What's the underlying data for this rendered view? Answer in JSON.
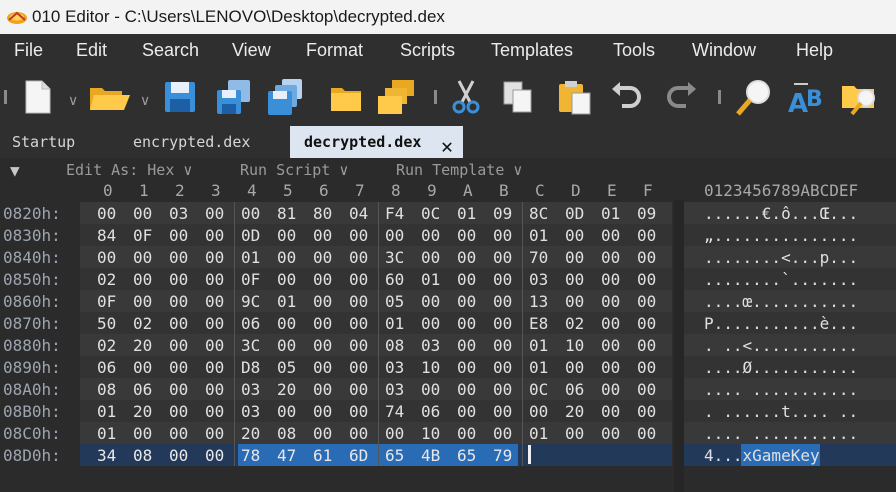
{
  "window": {
    "title": "010 Editor - C:\\Users\\LENOVO\\Desktop\\decrypted.dex"
  },
  "menu": [
    "File",
    "Edit",
    "Search",
    "View",
    "Format",
    "Scripts",
    "Templates",
    "Tools",
    "Window",
    "Help"
  ],
  "toolbar": {
    "icons": [
      "new-file-icon",
      "open-folder-icon",
      "save-icon",
      "save-as-icon",
      "save-all-icon",
      "folder-icon",
      "folders-icon",
      "cut-icon",
      "copy-icon",
      "paste-icon",
      "undo-icon",
      "redo-icon",
      "find-icon",
      "replace-icon",
      "find-in-files-icon"
    ]
  },
  "tabs": [
    {
      "label": "Startup",
      "active": false
    },
    {
      "label": "encrypted.dex",
      "active": false
    },
    {
      "label": "decrypted.dex",
      "active": true
    }
  ],
  "editor": {
    "edit_as": "Edit As: Hex",
    "run_script": "Run Script",
    "run_template": "Run Template",
    "hex_columns": [
      "0",
      "1",
      "2",
      "3",
      "4",
      "5",
      "6",
      "7",
      "8",
      "9",
      "A",
      "B",
      "C",
      "D",
      "E",
      "F"
    ],
    "text_header": "0123456789ABCDEF",
    "rows": [
      {
        "addr": "0820h:",
        "bytes": [
          "00",
          "00",
          "03",
          "00",
          "00",
          "81",
          "80",
          "04",
          "F4",
          "0C",
          "01",
          "09",
          "8C",
          "0D",
          "01",
          "09"
        ],
        "text": "......€.ô...Œ..."
      },
      {
        "addr": "0830h:",
        "bytes": [
          "84",
          "0F",
          "00",
          "00",
          "0D",
          "00",
          "00",
          "00",
          "00",
          "00",
          "00",
          "00",
          "01",
          "00",
          "00",
          "00"
        ],
        "text": "„..............."
      },
      {
        "addr": "0840h:",
        "bytes": [
          "00",
          "00",
          "00",
          "00",
          "01",
          "00",
          "00",
          "00",
          "3C",
          "00",
          "00",
          "00",
          "70",
          "00",
          "00",
          "00"
        ],
        "text": "........<...p..."
      },
      {
        "addr": "0850h:",
        "bytes": [
          "02",
          "00",
          "00",
          "00",
          "0F",
          "00",
          "00",
          "00",
          "60",
          "01",
          "00",
          "00",
          "03",
          "00",
          "00",
          "00"
        ],
        "text": "........`......."
      },
      {
        "addr": "0860h:",
        "bytes": [
          "0F",
          "00",
          "00",
          "00",
          "9C",
          "01",
          "00",
          "00",
          "05",
          "00",
          "00",
          "00",
          "13",
          "00",
          "00",
          "00"
        ],
        "text": "....œ..........."
      },
      {
        "addr": "0870h:",
        "bytes": [
          "50",
          "02",
          "00",
          "00",
          "06",
          "00",
          "00",
          "00",
          "01",
          "00",
          "00",
          "00",
          "E8",
          "02",
          "00",
          "00"
        ],
        "text": "P...........è..."
      },
      {
        "addr": "0880h:",
        "bytes": [
          "02",
          "20",
          "00",
          "00",
          "3C",
          "00",
          "00",
          "00",
          "08",
          "03",
          "00",
          "00",
          "01",
          "10",
          "00",
          "00"
        ],
        "text": ". ..<..........."
      },
      {
        "addr": "0890h:",
        "bytes": [
          "06",
          "00",
          "00",
          "00",
          "D8",
          "05",
          "00",
          "00",
          "03",
          "10",
          "00",
          "00",
          "01",
          "00",
          "00",
          "00"
        ],
        "text": "....Ø..........."
      },
      {
        "addr": "08A0h:",
        "bytes": [
          "08",
          "06",
          "00",
          "00",
          "03",
          "20",
          "00",
          "00",
          "03",
          "00",
          "00",
          "00",
          "0C",
          "06",
          "00",
          "00"
        ],
        "text": ".... ..........."
      },
      {
        "addr": "08B0h:",
        "bytes": [
          "01",
          "20",
          "00",
          "00",
          "03",
          "00",
          "00",
          "00",
          "74",
          "06",
          "00",
          "00",
          "00",
          "20",
          "00",
          "00"
        ],
        "text": ". ......t.... .."
      },
      {
        "addr": "08C0h:",
        "bytes": [
          "01",
          "00",
          "00",
          "00",
          "20",
          "08",
          "00",
          "00",
          "00",
          "10",
          "00",
          "00",
          "01",
          "00",
          "00",
          "00"
        ],
        "text": ".... ..........."
      },
      {
        "addr": "08D0h:",
        "bytes": [
          "34",
          "08",
          "00",
          "00",
          "78",
          "47",
          "61",
          "6D",
          "65",
          "4B",
          "65",
          "79"
        ],
        "text": "4...xGameKey"
      }
    ]
  },
  "colors": {
    "selection": "#2a6bb5",
    "background": "#2b2b2b",
    "active_tab": "#dde6f0"
  }
}
